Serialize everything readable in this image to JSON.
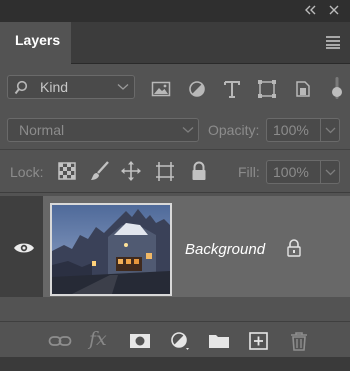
{
  "panel": {
    "tab_title": "Layers",
    "filter": {
      "kind_label": "Kind",
      "filter_buttons": [
        "image-filter-icon",
        "adjustment-filter-icon",
        "type-filter-icon",
        "shape-filter-icon",
        "smart-object-filter-icon"
      ]
    },
    "blend": {
      "mode": "Normal",
      "opacity_label": "Opacity:",
      "opacity_value": "100%"
    },
    "lock": {
      "label": "Lock:",
      "fill_label": "Fill:",
      "fill_value": "100%",
      "lock_buttons": [
        "lock-transparent-pixels-icon",
        "lock-image-pixels-icon",
        "lock-position-icon",
        "lock-artboard-icon",
        "lock-all-icon"
      ]
    },
    "layers": [
      {
        "name": "Background",
        "visible": true,
        "locked": true,
        "selected": true
      }
    ],
    "footer_buttons": [
      "link-layers-icon",
      "fx-icon",
      "add-mask-icon",
      "adjustment-layer-icon",
      "new-group-icon",
      "new-layer-icon",
      "delete-layer-icon"
    ],
    "footer_fx": "fx"
  },
  "colors": {
    "panel_bg": "#535353",
    "selected_row": "#686868",
    "text_dim": "#8c8c8c",
    "text_bright": "#ffffff"
  }
}
